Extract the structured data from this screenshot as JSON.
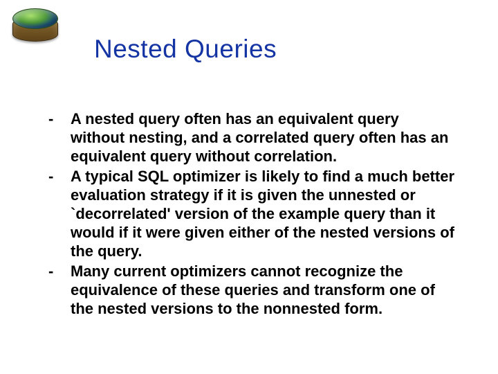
{
  "title": "Nested Queries",
  "bullets": [
    "A nested query often has an equivalent query without nesting, and a correlated query often has an equivalent query without correlation.",
    "A typical SQL optimizer is likely to find a much better evaluation strategy if it is given the unnested or `decorrelated' version of the example query than it would if it were given either of the nested versions of the query.",
    " Many current optimizers cannot recognize the equivalence of these queries and transform one of the nested versions to the nonnested form."
  ]
}
